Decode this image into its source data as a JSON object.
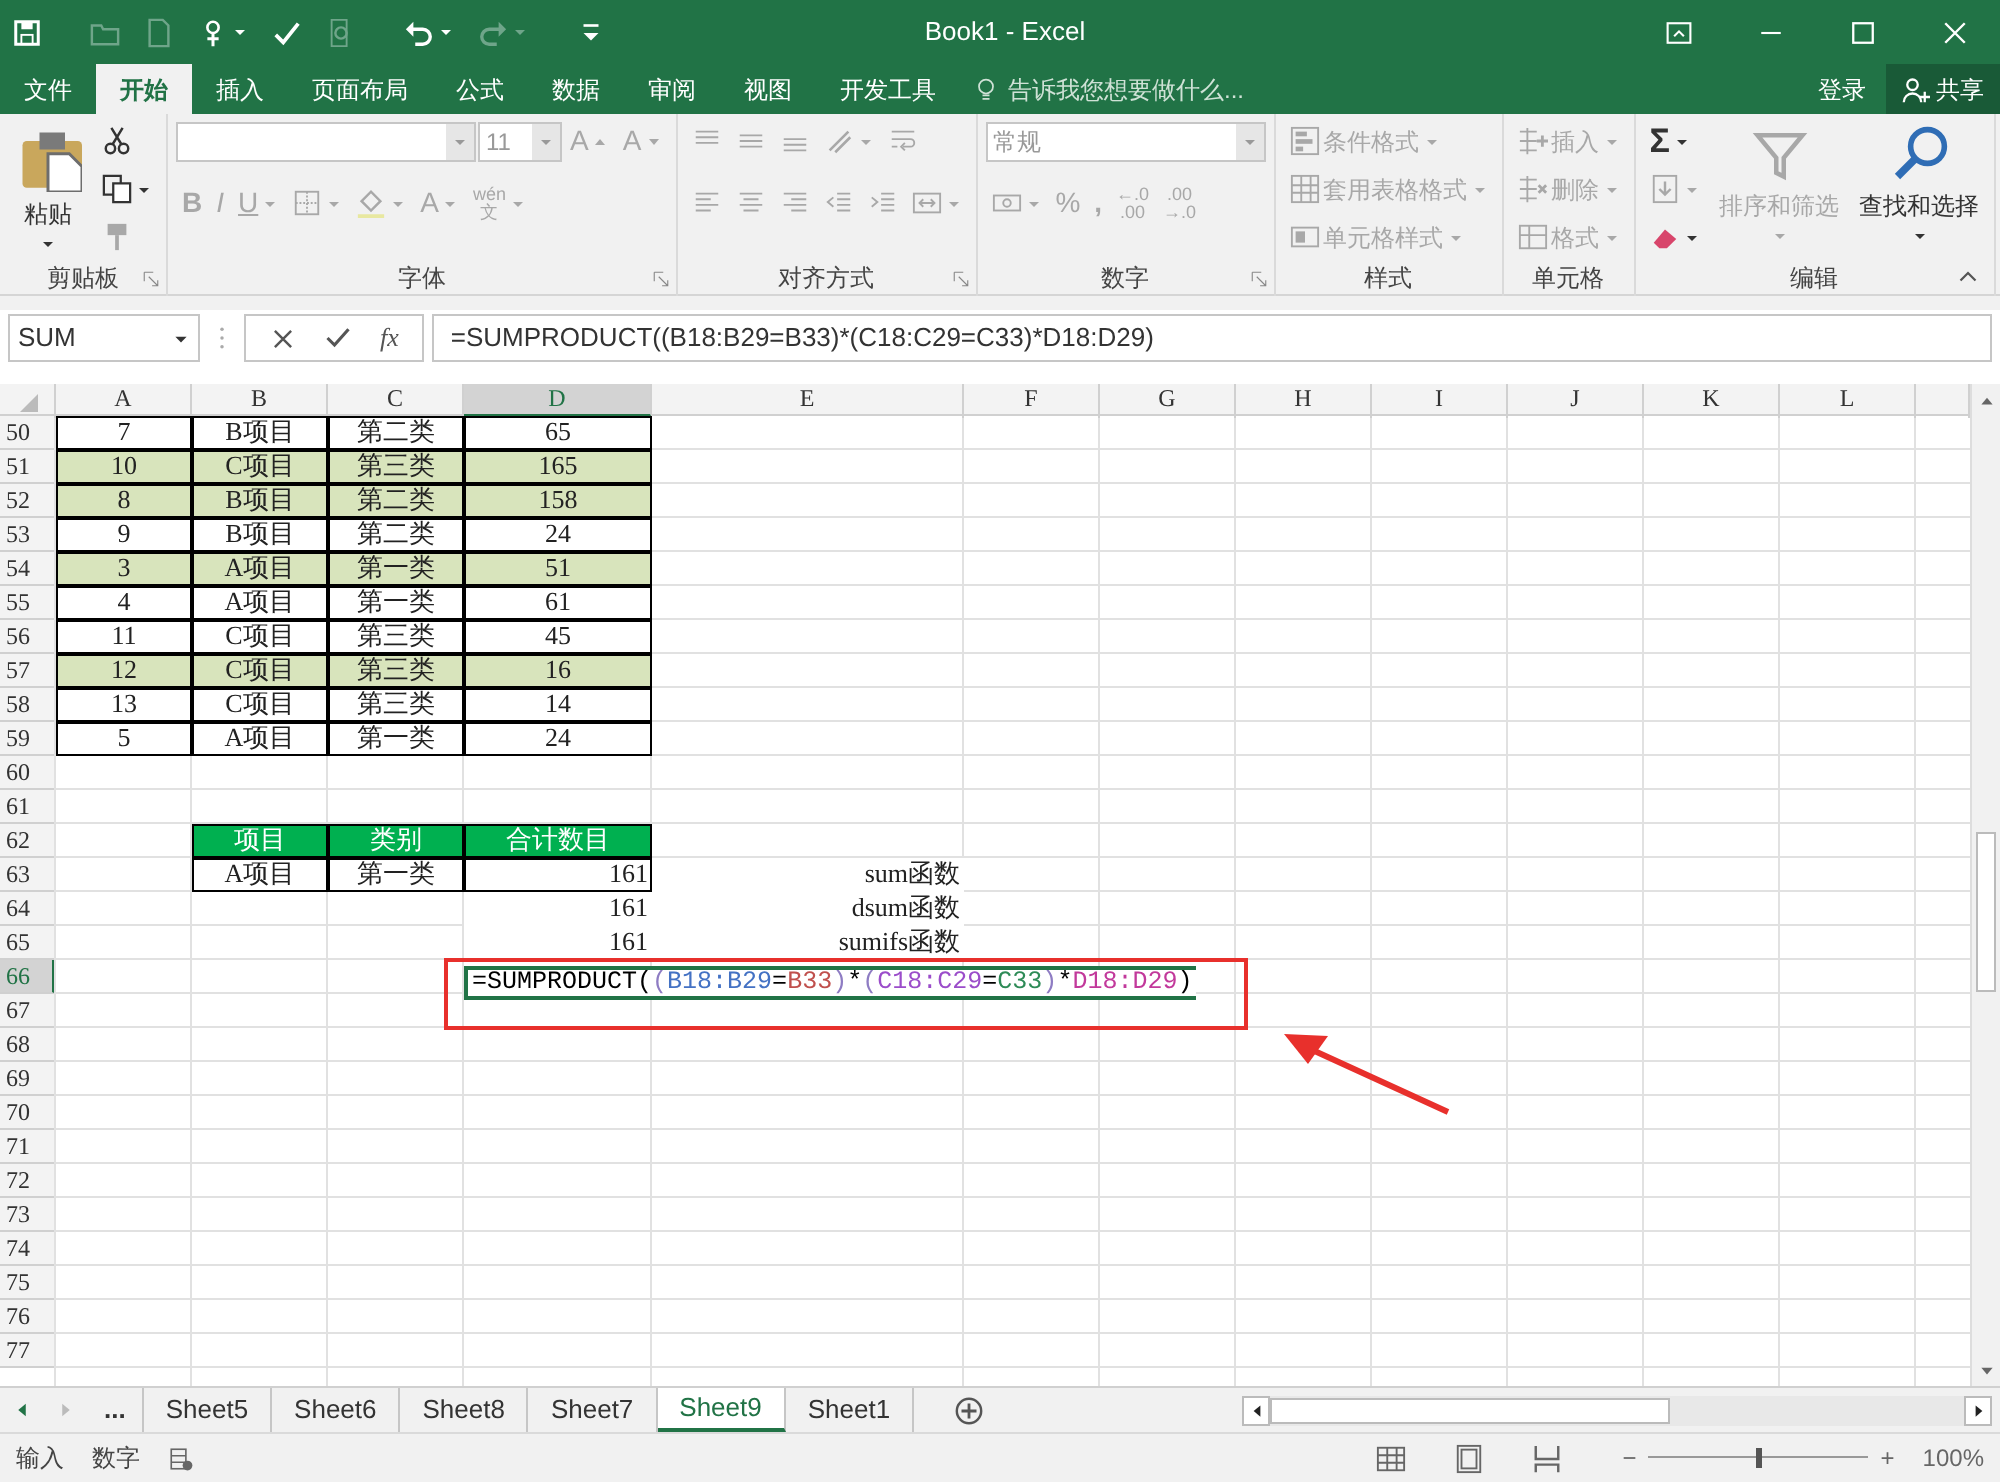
{
  "window": {
    "title": "Book1 - Excel"
  },
  "quick_access": [
    {
      "kind": "save",
      "disabled": false
    },
    {
      "kind": "open",
      "disabled": true
    },
    {
      "kind": "new",
      "disabled": true
    },
    {
      "kind": "touch",
      "disabled": false
    },
    {
      "kind": "spell",
      "disabled": false
    },
    {
      "kind": "preview",
      "disabled": true
    },
    {
      "kind": "undo",
      "disabled": false
    },
    {
      "kind": "redo",
      "disabled": true
    },
    {
      "kind": "customize",
      "disabled": false
    }
  ],
  "ribbon_tabs": [
    {
      "label": "文件",
      "selected": false
    },
    {
      "label": "开始",
      "selected": true
    },
    {
      "label": "插入",
      "selected": false
    },
    {
      "label": "页面布局",
      "selected": false
    },
    {
      "label": "公式",
      "selected": false
    },
    {
      "label": "数据",
      "selected": false
    },
    {
      "label": "审阅",
      "selected": false
    },
    {
      "label": "视图",
      "selected": false
    },
    {
      "label": "开发工具",
      "selected": false
    }
  ],
  "tell_me": {
    "placeholder": "告诉我您想要做什么..."
  },
  "sign_in": "登录",
  "share": "共享",
  "ribbon_groups": [
    {
      "label": "剪贴板",
      "columns": [
        {
          "kind": "big",
          "item": {
            "kind": "paste",
            "label": "粘贴",
            "disabled": false
          }
        },
        {
          "kind": "stack",
          "rows": [
            {
              "items": [
                {
                  "kind": "cut",
                  "disabled": false
                }
              ]
            },
            {
              "items": [
                {
                  "kind": "copy",
                  "disabled": false
                }
              ]
            },
            {
              "items": [
                {
                  "kind": "brush",
                  "disabled": true
                }
              ]
            }
          ]
        }
      ]
    },
    {
      "label": "字体",
      "columns": [
        {
          "kind": "stack",
          "rows": [
            {
              "items": [
                {
                  "kind": "font-combo",
                  "disabled": true
                },
                {
                  "kind": "size-combo",
                  "value": "11",
                  "disabled": true
                },
                {
                  "kind": "grow",
                  "label": "A",
                  "disabled": true
                },
                {
                  "kind": "shrink",
                  "label": "A",
                  "disabled": true
                }
              ]
            },
            {
              "items": [
                {
                  "kind": "bold-text",
                  "label": "B",
                  "disabled": true
                },
                {
                  "kind": "italic-text",
                  "label": "I",
                  "disabled": true
                },
                {
                  "kind": "underline-text",
                  "label": "U",
                  "disabled": true
                },
                {
                  "kind": "border",
                  "disabled": true
                },
                {
                  "kind": "bucket",
                  "disabled": true
                },
                {
                  "kind": "font-color",
                  "label": "A",
                  "disabled": true
                },
                {
                  "kind": "phonetic",
                  "label": "wén",
                  "sublabel": "文",
                  "disabled": true
                }
              ]
            }
          ]
        }
      ]
    },
    {
      "label": "对齐方式",
      "columns": [
        {
          "kind": "stack",
          "rows": [
            {
              "items": [
                {
                  "kind": "top",
                  "disabled": true
                },
                {
                  "kind": "middle",
                  "disabled": true
                },
                {
                  "kind": "bottom",
                  "disabled": true
                },
                {
                  "kind": "angle",
                  "disabled": true
                },
                {
                  "kind": "wrap",
                  "disabled": true
                }
              ]
            },
            {
              "items": [
                {
                  "kind": "left",
                  "disabled": true
                },
                {
                  "kind": "center",
                  "disabled": true
                },
                {
                  "kind": "right",
                  "disabled": true
                },
                {
                  "kind": "outdent",
                  "disabled": true
                },
                {
                  "kind": "indent",
                  "disabled": true
                },
                {
                  "kind": "merge",
                  "disabled": true
                }
              ]
            }
          ]
        }
      ]
    },
    {
      "label": "数字",
      "columns": [
        {
          "kind": "stack",
          "rows": [
            {
              "items": [
                {
                  "kind": "format-combo",
                  "value": "常规",
                  "disabled": true
                }
              ]
            },
            {
              "items": [
                {
                  "kind": "currency",
                  "disabled": true
                },
                {
                  "kind": "text",
                  "label": "%",
                  "disabled": true
                },
                {
                  "kind": "bold-text",
                  "label": ",",
                  "disabled": true
                },
                {
                  "kind": "decimal",
                  "label": "←.0",
                  "sublabel": ".00",
                  "disabled": true
                },
                {
                  "kind": "decimal",
                  "label": ".00",
                  "sublabel": "→.0",
                  "disabled": true
                }
              ]
            }
          ]
        }
      ]
    },
    {
      "label": "样式",
      "columns": [
        {
          "kind": "stack",
          "rows": [
            {
              "items": [
                {
                  "kind": "cond",
                  "label": "条件格式",
                  "disabled": true
                }
              ]
            },
            {
              "items": [
                {
                  "kind": "table",
                  "label": "套用表格格式",
                  "disabled": true
                }
              ]
            },
            {
              "items": [
                {
                  "kind": "cellstyle",
                  "label": "单元格样式",
                  "disabled": true
                }
              ]
            }
          ]
        }
      ]
    },
    {
      "label": "单元格",
      "columns": [
        {
          "kind": "stack",
          "rows": [
            {
              "items": [
                {
                  "kind": "insert",
                  "label": "插入",
                  "disabled": true
                }
              ]
            },
            {
              "items": [
                {
                  "kind": "delete",
                  "label": "删除",
                  "disabled": true
                }
              ]
            },
            {
              "items": [
                {
                  "kind": "format",
                  "label": "格式",
                  "disabled": true
                }
              ]
            }
          ]
        }
      ]
    },
    {
      "label": "编辑",
      "columns": [
        {
          "kind": "stack",
          "rows": [
            {
              "items": [
                {
                  "kind": "sum",
                  "label": "Σ",
                  "disabled": false
                }
              ]
            },
            {
              "items": [
                {
                  "kind": "fill",
                  "disabled": true
                }
              ]
            },
            {
              "items": [
                {
                  "kind": "eraser",
                  "disabled": false
                }
              ]
            }
          ]
        },
        {
          "kind": "big",
          "item": {
            "kind": "sort",
            "label": "排序和筛选",
            "disabled": true
          }
        },
        {
          "kind": "big",
          "item": {
            "kind": "find",
            "label": "查找和选择",
            "disabled": false
          }
        }
      ]
    }
  ],
  "formula_bar": {
    "name_box": "SUM",
    "fx": "fx",
    "formula": "=SUMPRODUCT((B18:B29=B33)*(C18:C29=C33)*D18:D29)"
  },
  "columns": [
    {
      "label": "A",
      "selected": false
    },
    {
      "label": "B",
      "selected": false
    },
    {
      "label": "C",
      "selected": false
    },
    {
      "label": "D",
      "selected": true
    },
    {
      "label": "E",
      "selected": false
    },
    {
      "label": "F",
      "selected": false
    },
    {
      "label": "G",
      "selected": false
    },
    {
      "label": "H",
      "selected": false
    },
    {
      "label": "I",
      "selected": false
    },
    {
      "label": "J",
      "selected": false
    },
    {
      "label": "K",
      "selected": false
    },
    {
      "label": "L",
      "selected": false
    }
  ],
  "rows": [
    {
      "label": "50",
      "selected": false
    },
    {
      "label": "51",
      "selected": false
    },
    {
      "label": "52",
      "selected": false
    },
    {
      "label": "53",
      "selected": false
    },
    {
      "label": "54",
      "selected": false
    },
    {
      "label": "55",
      "selected": false
    },
    {
      "label": "56",
      "selected": false
    },
    {
      "label": "57",
      "selected": false
    },
    {
      "label": "58",
      "selected": false
    },
    {
      "label": "59",
      "selected": false
    },
    {
      "label": "60",
      "selected": false
    },
    {
      "label": "61",
      "selected": false
    },
    {
      "label": "62",
      "selected": false
    },
    {
      "label": "63",
      "selected": false
    },
    {
      "label": "64",
      "selected": false
    },
    {
      "label": "65",
      "selected": false
    },
    {
      "label": "66",
      "selected": true
    },
    {
      "label": "67",
      "selected": false
    },
    {
      "label": "68",
      "selected": false
    },
    {
      "label": "69",
      "selected": false
    },
    {
      "label": "70",
      "selected": false
    },
    {
      "label": "71",
      "selected": false
    },
    {
      "label": "72",
      "selected": false
    },
    {
      "label": "73",
      "selected": false
    },
    {
      "label": "74",
      "selected": false
    },
    {
      "label": "75",
      "selected": false
    },
    {
      "label": "76",
      "selected": false
    },
    {
      "label": "77",
      "selected": false
    }
  ],
  "data_table": {
    "rows": [
      {
        "cells": [
          "7",
          "B项目",
          "第二类",
          "65"
        ],
        "highlighted": false
      },
      {
        "cells": [
          "10",
          "C项目",
          "第三类",
          "165"
        ],
        "highlighted": true
      },
      {
        "cells": [
          "8",
          "B项目",
          "第二类",
          "158"
        ],
        "highlighted": true
      },
      {
        "cells": [
          "9",
          "B项目",
          "第二类",
          "24"
        ],
        "highlighted": false
      },
      {
        "cells": [
          "3",
          "A项目",
          "第一类",
          "51"
        ],
        "highlighted": true
      },
      {
        "cells": [
          "4",
          "A项目",
          "第一类",
          "61"
        ],
        "highlighted": false
      },
      {
        "cells": [
          "11",
          "C项目",
          "第三类",
          "45"
        ],
        "highlighted": false
      },
      {
        "cells": [
          "12",
          "C项目",
          "第三类",
          "16"
        ],
        "highlighted": true
      },
      {
        "cells": [
          "13",
          "C项目",
          "第三类",
          "14"
        ],
        "highlighted": false
      },
      {
        "cells": [
          "5",
          "A项目",
          "第一类",
          "24"
        ],
        "highlighted": false
      }
    ]
  },
  "summary_table": {
    "header": [
      "项目",
      "类别",
      "合计数目"
    ],
    "row": [
      "A项目",
      "第一类",
      "161"
    ]
  },
  "results": [
    {
      "label": "sum函数"
    },
    {
      "value": "161",
      "label": "dsum函数"
    },
    {
      "value": "161",
      "label": "sumifs函数"
    }
  ],
  "cell_editor": {
    "parts": [
      {
        "text": "=SUMPRODUCT(",
        "color": "#000000"
      },
      {
        "text": "(",
        "color": "#8e7cc3"
      },
      {
        "text": "B18:B29",
        "color": "#4472c4"
      },
      {
        "text": "=",
        "color": "#000000"
      },
      {
        "text": "B33",
        "color": "#c0504d"
      },
      {
        "text": ")",
        "color": "#8e7cc3"
      },
      {
        "text": "*",
        "color": "#000000"
      },
      {
        "text": "(",
        "color": "#8e7cc3"
      },
      {
        "text": "C18:C29",
        "color": "#9b4dca"
      },
      {
        "text": "=",
        "color": "#000000"
      },
      {
        "text": "C33",
        "color": "#2e8b57"
      },
      {
        "text": ")",
        "color": "#8e7cc3"
      },
      {
        "text": "*",
        "color": "#000000"
      },
      {
        "text": "D18:D29",
        "color": "#c2399b"
      },
      {
        "text": ")",
        "color": "#000000"
      }
    ]
  },
  "sheet_tabs": {
    "overflow": "...",
    "tabs": [
      {
        "label": "Sheet5",
        "selected": false
      },
      {
        "label": "Sheet6",
        "selected": false
      },
      {
        "label": "Sheet8",
        "selected": false
      },
      {
        "label": "Sheet7",
        "selected": false
      },
      {
        "label": "Sheet9",
        "selected": true
      },
      {
        "label": "Sheet1",
        "selected": false
      }
    ]
  },
  "status_bar": {
    "mode": "输入",
    "format": "数字",
    "zoom": {
      "minus": "−",
      "plus": "+",
      "level": 0.5,
      "reading": "100%"
    }
  }
}
